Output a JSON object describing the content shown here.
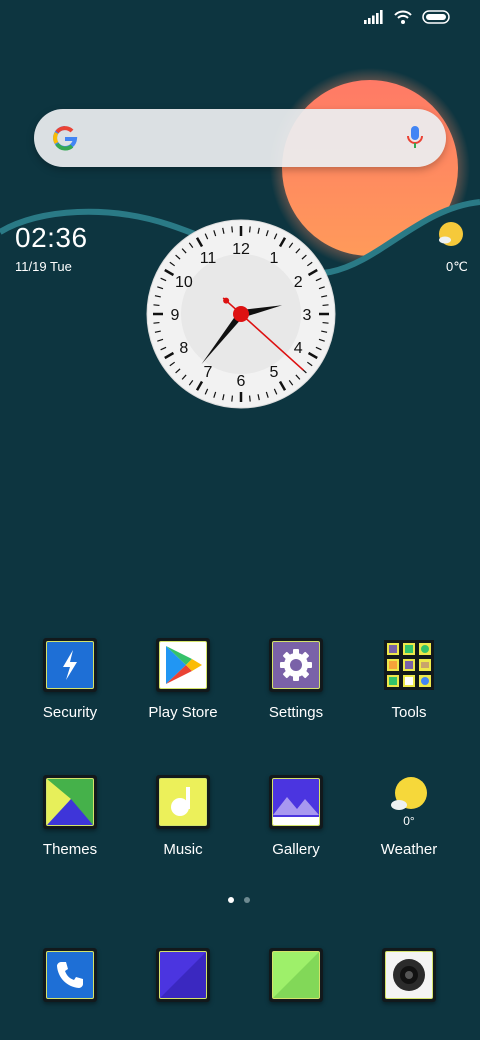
{
  "status": {
    "icons": [
      "signal-icon",
      "wifi-icon",
      "battery-icon"
    ]
  },
  "search": {
    "icon_left": "google-logo-icon",
    "icon_right": "mic-icon"
  },
  "widget": {
    "time": "02:36",
    "date": "11/19 Tue",
    "weather_temp": "0℃"
  },
  "analog_clock": {
    "numerals": [
      "12",
      "1",
      "2",
      "3",
      "4",
      "5",
      "6",
      "7",
      "8",
      "9",
      "10",
      "11"
    ],
    "hour": 2,
    "minute": 36,
    "second": 22
  },
  "apps": [
    {
      "label": "Security",
      "icon": "security-icon"
    },
    {
      "label": "Play Store",
      "icon": "play-store-icon"
    },
    {
      "label": "Settings",
      "icon": "gear-icon"
    },
    {
      "label": "Tools",
      "icon": "tools-folder-icon"
    },
    {
      "label": "Themes",
      "icon": "themes-icon"
    },
    {
      "label": "Music",
      "icon": "music-icon"
    },
    {
      "label": "Gallery",
      "icon": "gallery-icon"
    },
    {
      "label": "Weather",
      "icon": "weather-icon",
      "temp": "0°"
    }
  ],
  "pages": {
    "count": 2,
    "active": 0
  },
  "dock": [
    {
      "icon": "phone-icon"
    },
    {
      "icon": "messaging-icon"
    },
    {
      "icon": "browser-icon"
    },
    {
      "icon": "camera-icon"
    }
  ],
  "colors": {
    "background": "#0d3540",
    "sun": "#ff7a5c",
    "wave": "#2a7a86",
    "accent_border": "#d4e36a"
  }
}
